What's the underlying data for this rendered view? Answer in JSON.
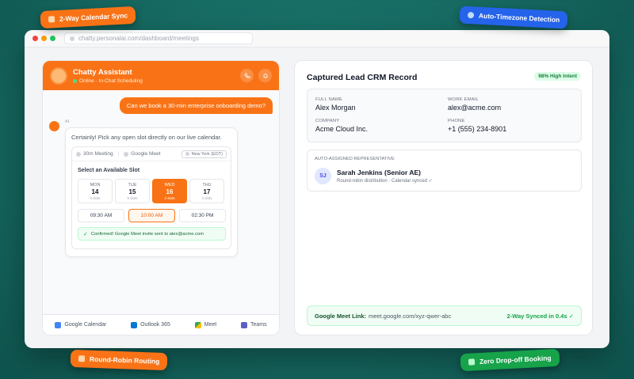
{
  "browser": {
    "url": "chatty.personalai.com/dashboard/meetings"
  },
  "badges": {
    "calendar_sync": "2-Way Calendar Sync",
    "timezone": "Auto-Timezone Detection",
    "round_robin": "Round-Robin Routing",
    "zero_dropoff": "Zero Drop-off Booking"
  },
  "chat": {
    "title": "Chatty Assistant",
    "status": "Online · In-Chat Scheduling",
    "user_message": "Can we book a 30-min enterprise onboarding demo?",
    "ai_label": "AI",
    "ai_message": "Certainly! Pick any open slot directly on our live calendar.",
    "widget": {
      "duration": "30m Meeting",
      "platform": "Google Meet",
      "timezone": "New York (EDT)",
      "slot_title": "Select an Available Slot",
      "days": [
        {
          "name": "MON",
          "date": "14",
          "slots": "3 slots"
        },
        {
          "name": "TUE",
          "date": "15",
          "slots": "5 slots"
        },
        {
          "name": "WED",
          "date": "16",
          "slots": "2 slots"
        },
        {
          "name": "THU",
          "date": "17",
          "slots": "4 slots"
        }
      ],
      "times": [
        "09:30 AM",
        "10:00 AM",
        "02:30 PM"
      ],
      "confirmation": "Confirmed! Google Meet invite sent to alex@acme.com"
    },
    "integrations": [
      "Google Calendar",
      "Outlook 365",
      "Meet",
      "Teams"
    ]
  },
  "crm": {
    "title": "Captured Lead CRM Record",
    "intent": "98% High Intent",
    "fields": {
      "full_name_label": "FULL NAME",
      "full_name": "Alex Morgan",
      "email_label": "WORK EMAIL",
      "email": "alex@acme.com",
      "company_label": "COMPANY",
      "company": "Acme Cloud Inc.",
      "phone_label": "PHONE",
      "phone": "+1 (555) 234-8901"
    },
    "rep": {
      "label": "AUTO-ASSIGNED REPRESENTATIVE",
      "initials": "SJ",
      "name": "Sarah Jenkins (Senior AE)",
      "sub": "Round-robin distribution · Calendar synced ✓"
    },
    "meet": {
      "label": "Google Meet Link:",
      "url": "meet.google.com/xyz-qwer-abc",
      "synced": "2-Way Synced in 0.4s ✓"
    }
  },
  "colors": {
    "accent": "#f97316",
    "background": "#166a62",
    "success": "#16a34a",
    "info": "#2563eb"
  }
}
